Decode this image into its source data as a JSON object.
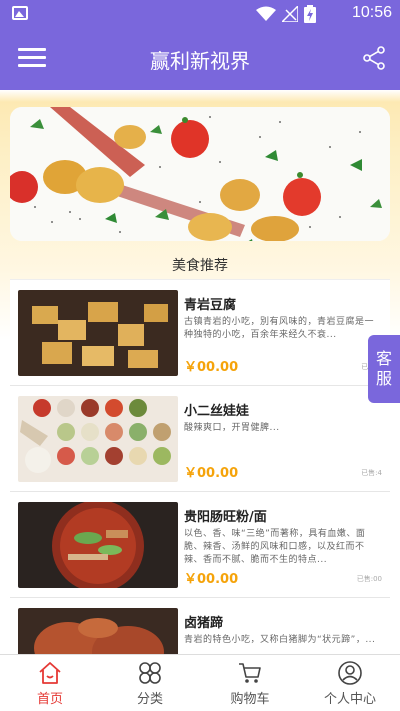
{
  "status_bar": {
    "time": "10:56",
    "icons": [
      "image-icon",
      "wifi-icon",
      "signal-icon",
      "battery-icon"
    ]
  },
  "app_bar": {
    "title": "赢利新视界",
    "left_icon": "menu-icon",
    "right_icon": "share-icon"
  },
  "section": {
    "title": "美食推荐"
  },
  "foods": [
    {
      "name": "青岩豆腐",
      "desc": "古镇青岩的小吃，別有风味的，青岩豆腐是一种独特的小吃，百余年来经久不衰...",
      "price": "￥00.00",
      "sold": "已售:4"
    },
    {
      "name": "小二丝娃娃",
      "desc": "酸辣爽口，开胃健脾...",
      "price": "￥00.00",
      "sold": "已售:4"
    },
    {
      "name": "贵阳肠旺粉/面",
      "desc": "以色、香、味“三绝”而著称，具有血嫩、面脆、辣香、汤鲜的风味和口感，以及红而不辣、香而不腻、脆而不生的特点...",
      "price": "￥00.00",
      "sold": "已售:00"
    },
    {
      "name": "卤猪蹄",
      "desc": "青岩的特色小吃，又称白猪脚为“状元蹄”，...",
      "price": "",
      "sold": ""
    }
  ],
  "service_button": {
    "chars": [
      "客",
      "服"
    ]
  },
  "tabs": [
    {
      "label": "首页",
      "icon": "home-icon",
      "active": true
    },
    {
      "label": "分类",
      "icon": "category-icon",
      "active": false
    },
    {
      "label": "购物车",
      "icon": "cart-icon",
      "active": false
    },
    {
      "label": "个人中心",
      "icon": "user-icon",
      "active": false
    }
  ],
  "colors": {
    "primary": "#7a67dc",
    "active_tab": "#e53935",
    "price": "#f5a30a"
  }
}
